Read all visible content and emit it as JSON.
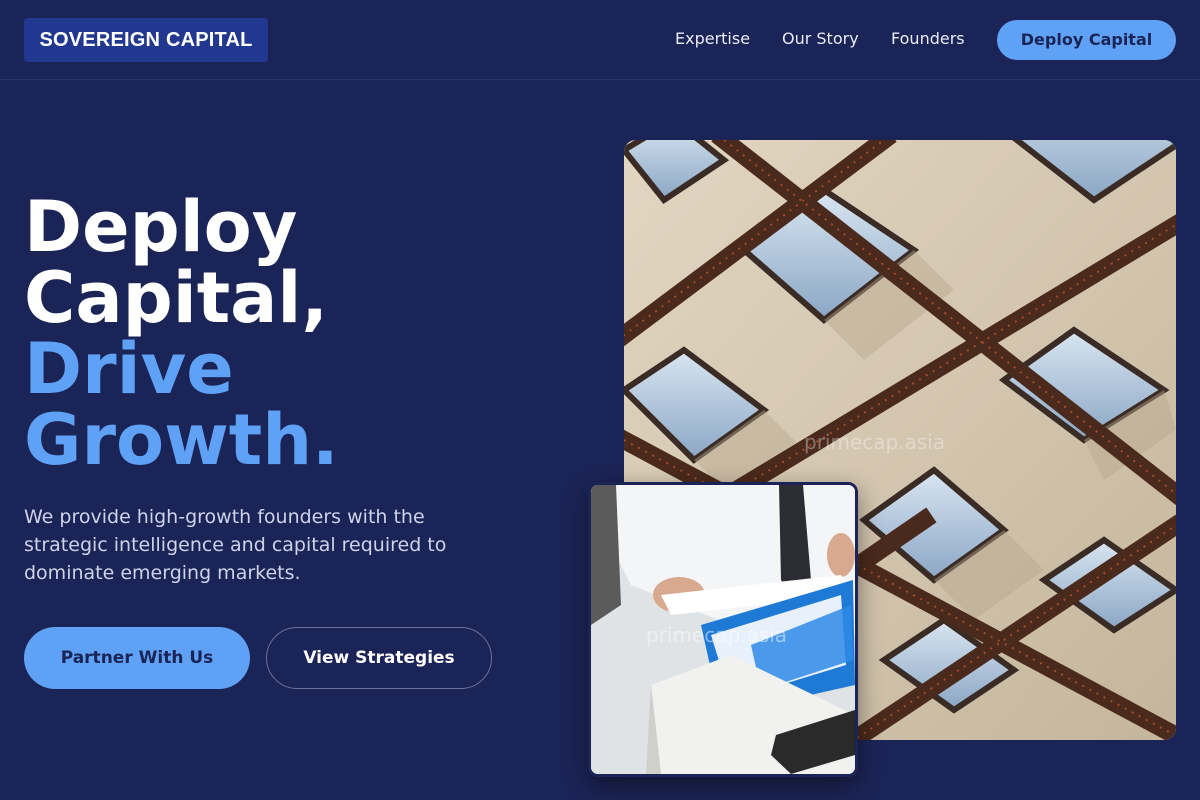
{
  "header": {
    "logo": "SOVEREIGN CAPITAL",
    "nav": {
      "expertise": "Expertise",
      "story": "Our Story",
      "founders": "Founders"
    },
    "cta": "Deploy Capital"
  },
  "hero": {
    "headline": {
      "line1": "Deploy",
      "line2": "Capital,",
      "line3": "Drive",
      "line4": "Growth."
    },
    "subtext": "We provide high-growth founders with the strategic intelligence and capital required to dominate emerging markets.",
    "primary_button": "Partner With Us",
    "secondary_button": "View Strategies"
  },
  "images": {
    "main_watermark": "primecap.asia",
    "small_watermark": "primecap.asia"
  },
  "colors": {
    "background": "#1b2456",
    "accent": "#5ea1f5",
    "logo_bg": "#22378f"
  }
}
